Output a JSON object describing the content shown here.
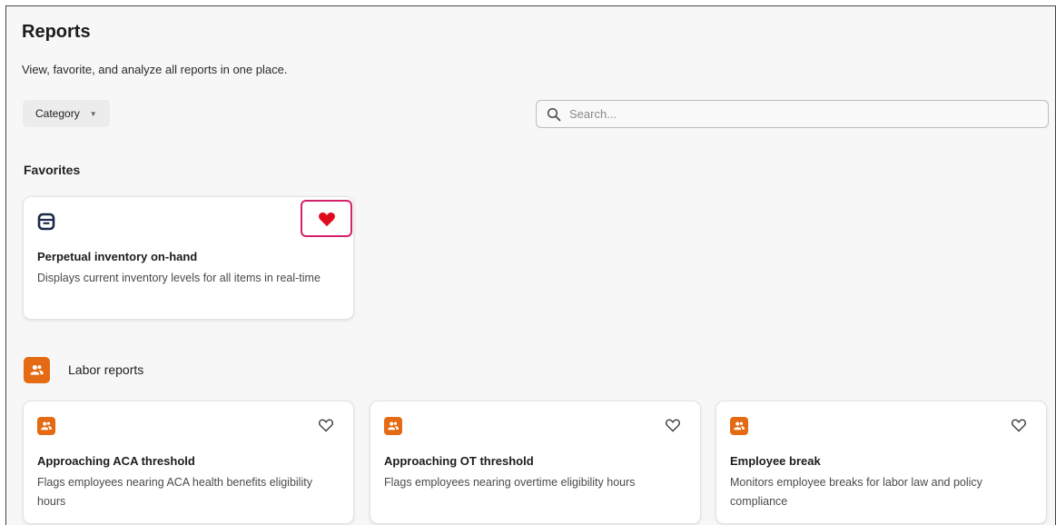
{
  "header": {
    "title": "Reports",
    "subtitle": "View, favorite, and analyze all reports in one place."
  },
  "filters": {
    "category_label": "Category",
    "search_placeholder": "Search..."
  },
  "favorites": {
    "heading": "Favorites",
    "cards": [
      {
        "title": "Perpetual inventory on-hand",
        "description": "Displays current inventory levels for all items in real-time",
        "icon": "inventory-box-icon",
        "favorited": true
      }
    ]
  },
  "labor": {
    "heading": "Labor reports",
    "icon": "people-icon",
    "cards": [
      {
        "title": "Approaching ACA threshold",
        "description": "Flags employees nearing ACA health benefits eligibility hours",
        "icon": "people-icon",
        "favorited": false
      },
      {
        "title": "Approaching OT threshold",
        "description": "Flags employees nearing overtime eligibility hours",
        "icon": "people-icon",
        "favorited": false
      },
      {
        "title": "Employee break",
        "description": "Monitors employee breaks for labor law and policy compliance",
        "icon": "people-icon",
        "favorited": false
      }
    ]
  },
  "colors": {
    "accent_orange": "#e46b13",
    "heart_red": "#e00b1c",
    "focus_pink": "#d4226a",
    "inventory_icon_navy": "#1b2a4a"
  }
}
